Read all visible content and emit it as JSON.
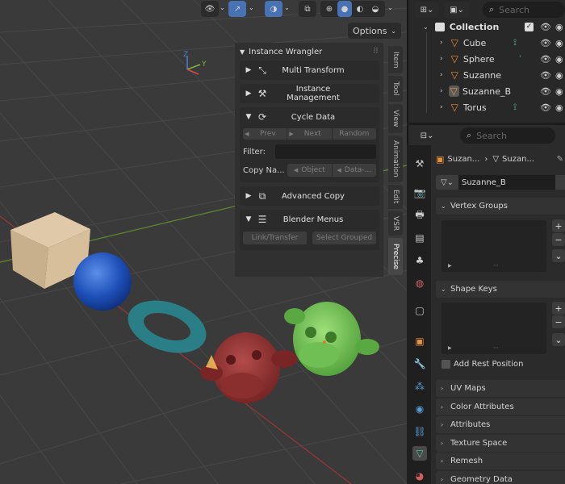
{
  "header": {
    "options_label": "Options"
  },
  "npanel": {
    "title": "Instance Wrangler",
    "sections": {
      "multi_transform": "Multi Transform",
      "instance_management": "Instance Management",
      "cycle_data": "Cycle Data",
      "advanced_copy": "Advanced Copy",
      "blender_menus": "Blender Menus"
    },
    "cycle": {
      "prev": "Prev",
      "next": "Next",
      "random": "Random",
      "filter_label": "Filter:",
      "filter_value": "",
      "copy_label": "Copy Na...",
      "object": "Object",
      "data": "Data-..."
    },
    "menus": {
      "link_transfer": "Link/Transfer",
      "select_grouped": "Select Grouped"
    }
  },
  "vtabs": [
    "Item",
    "Tool",
    "View",
    "Animation",
    "Edit",
    "VSR",
    "Precise"
  ],
  "outliner": {
    "search_placeholder": "Search",
    "collection": "Collection",
    "items": [
      "Cube",
      "Sphere",
      "Suzanne",
      "Suzanne_B",
      "Torus"
    ]
  },
  "properties": {
    "search_placeholder": "Search",
    "breadcrumb_object": "Suzan...",
    "breadcrumb_data": "Suzan...",
    "mesh_name": "Suzanne_B",
    "sections": {
      "vertex_groups": "Vertex Groups",
      "shape_keys": "Shape Keys",
      "add_rest_position": "Add Rest Position",
      "uv_maps": "UV Maps",
      "color_attributes": "Color Attributes",
      "attributes": "Attributes",
      "texture_space": "Texture Space",
      "remesh": "Remesh",
      "geometry_data": "Geometry Data"
    }
  },
  "gizmo": {
    "x": "X",
    "y": "Y",
    "z": "Z"
  },
  "colors": {
    "accent": "#4772b3",
    "mesh_icon": "#4fc3a1",
    "object_icon": "#e8913a"
  }
}
